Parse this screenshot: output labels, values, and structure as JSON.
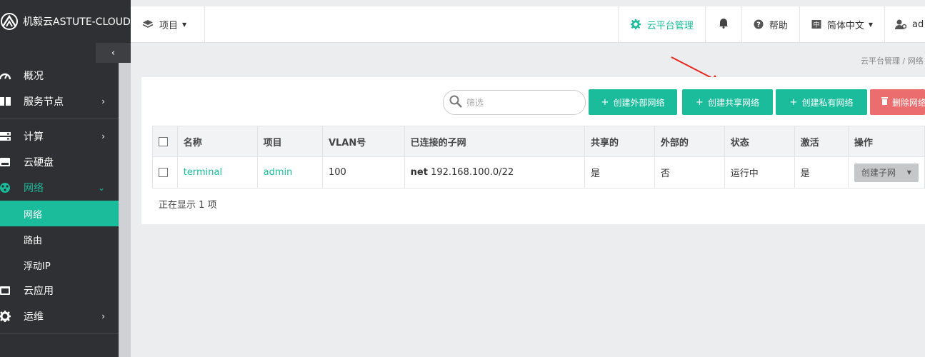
{
  "brand": {
    "name": "机毅云ASTUTE-CLOUD"
  },
  "sidebar": {
    "collapse_icon": "‹",
    "items": [
      {
        "label": "概况",
        "icon": "dashboard-icon"
      },
      {
        "label": "服务节点",
        "icon": "book-icon",
        "arrow": "›"
      },
      {
        "label": "计算",
        "icon": "server-icon",
        "arrow": "›"
      },
      {
        "label": "云硬盘",
        "icon": "drive-icon"
      },
      {
        "label": "网络",
        "icon": "network-icon",
        "arrow": "⌄"
      },
      {
        "label": "云应用",
        "icon": "app-icon"
      },
      {
        "label": "运维",
        "icon": "gear-icon",
        "arrow": "›"
      }
    ],
    "network_submenu": [
      {
        "label": "网络"
      },
      {
        "label": "路由"
      },
      {
        "label": "浮动IP"
      }
    ]
  },
  "topbar": {
    "project_label": "项目",
    "cloud_admin": "云平台管理",
    "help": "帮助",
    "language": "简体中文",
    "user": "ad"
  },
  "breadcrumb": "云平台管理 / 网络",
  "toolbar": {
    "search_placeholder": "筛选",
    "create_external": "创建外部网络",
    "create_shared": "创建共享网络",
    "create_private": "创建私有网络",
    "delete_network": "删除网络"
  },
  "table": {
    "headers": [
      "名称",
      "项目",
      "VLAN号",
      "已连接的子网",
      "共享的",
      "外部的",
      "状态",
      "激活",
      "操作"
    ],
    "rows": [
      {
        "name": "terminal",
        "project": "admin",
        "vlan": "100",
        "subnet_name": "net",
        "subnet_cidr": "192.168.100.0/22",
        "shared": "是",
        "external": "否",
        "status": "运行中",
        "active": "是",
        "action": "创建子网"
      }
    ]
  },
  "footer": "正在显示 1 项",
  "colors": {
    "accent": "#1abc9c",
    "danger": "#ec6d6d",
    "sidebar": "#2f3033"
  }
}
